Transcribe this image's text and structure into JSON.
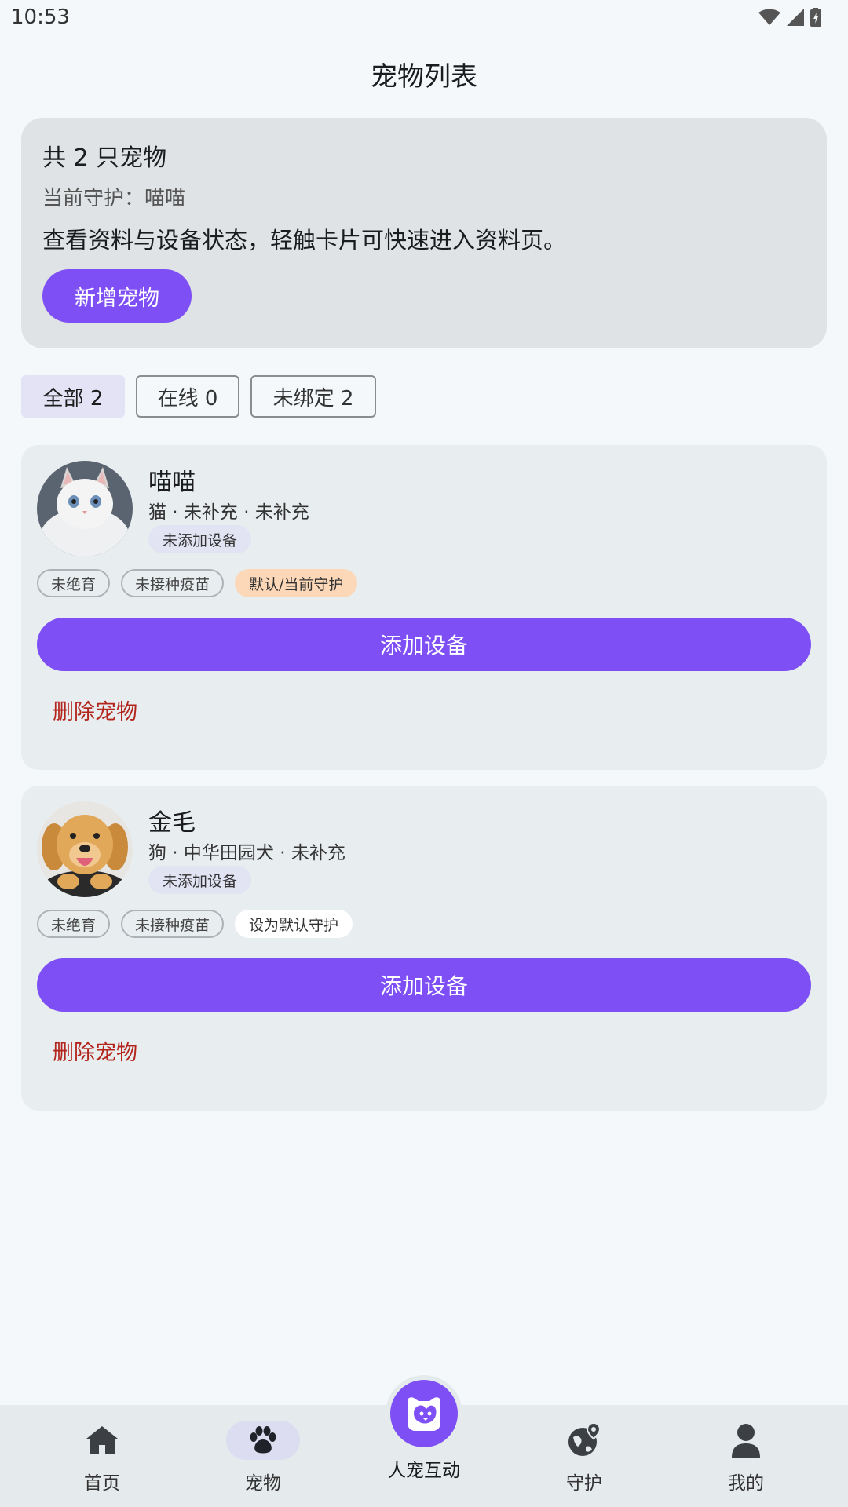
{
  "status": {
    "time": "10:53"
  },
  "page_title": "宠物列表",
  "summary": {
    "count_text": "共 2 只宠物",
    "guard_text": "当前守护：喵喵",
    "description": "查看资料与设备状态，轻触卡片可快速进入资料页。",
    "add_pet_label": "新增宠物"
  },
  "filters": [
    {
      "label": "全部 2",
      "active": true
    },
    {
      "label": "在线 0",
      "active": false
    },
    {
      "label": "未绑定 2",
      "active": false
    }
  ],
  "pets": [
    {
      "name": "喵喵",
      "meta": "猫 · 未补充 · 未补充",
      "device_status": "未添加设备",
      "tags": [
        "未绝育",
        "未接种疫苗",
        "默认/当前守护"
      ],
      "add_device_label": "添加设备",
      "delete_label": "删除宠物"
    },
    {
      "name": "金毛",
      "meta": "狗 · 中华田园犬 · 未补充",
      "device_status": "未添加设备",
      "tags": [
        "未绝育",
        "未接种疫苗",
        "设为默认守护"
      ],
      "add_device_label": "添加设备",
      "delete_label": "删除宠物"
    }
  ],
  "nav": {
    "home": "首页",
    "pets": "宠物",
    "interact": "人宠互动",
    "guard": "守护",
    "mine": "我的",
    "active": "pets"
  },
  "colors": {
    "accent": "#7d4ff5",
    "danger": "#b3261e",
    "guard_tag": "#fdd8b8"
  }
}
